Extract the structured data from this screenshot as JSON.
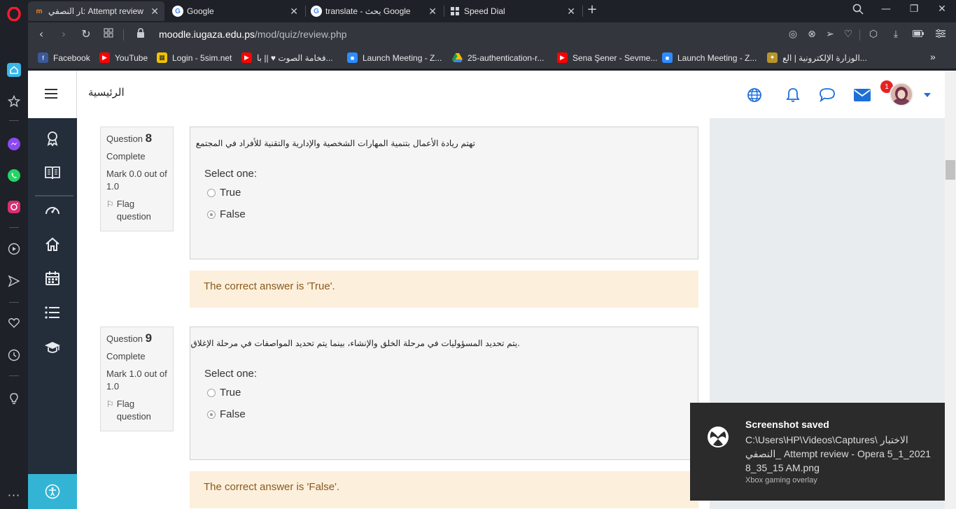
{
  "browser": {
    "tabs": [
      {
        "title": "ﺎﺭ ﺍﻟﻨﺼﻔﻲ: Attempt review",
        "icon": "moodle-icon",
        "active": true
      },
      {
        "title": "Google",
        "icon": "google-icon",
        "active": false
      },
      {
        "title": "translate - ﺑﺤﺚ Google",
        "icon": "google-icon",
        "active": false
      },
      {
        "title": "Speed Dial",
        "icon": "speed-dial-icon",
        "active": false
      }
    ],
    "new_tab": "+",
    "url_host": "moodle.iugaza.edu.ps",
    "url_path": "/mod/quiz/review.php",
    "bookmarks": [
      {
        "label": "Facebook",
        "icon": "facebook-icon"
      },
      {
        "label": "YouTube",
        "icon": "youtube-icon"
      },
      {
        "label": "Login - 5sim.net",
        "icon": "5sim-icon"
      },
      {
        "label": "ﻓﺨﺎﻣﺔ ﺍﻟﺼﻮﺕ ♥ || ﺑﺎ...",
        "icon": "youtube-icon"
      },
      {
        "label": "Launch Meeting - Z...",
        "icon": "zoom-icon"
      },
      {
        "label": "25-authentication-r...",
        "icon": "drive-icon"
      },
      {
        "label": "Sena Şener - Sevme...",
        "icon": "youtube-icon"
      },
      {
        "label": "Launch Meeting - Z...",
        "icon": "zoom-icon"
      },
      {
        "label": "ﺍﻟﻮﺯﺍﺭﺓ ﺍﻹﻟﻜﺘﺮﻭﻧﻴﺔ | ﺍﻟﻊ...",
        "icon": "ministry-icon"
      }
    ],
    "bookmarks_more": "»"
  },
  "moodle": {
    "home_title": "ﺍﻟﺮﺋﻴﺴﻴﺔ",
    "notification_count": "1",
    "accent": "#1d6fd8"
  },
  "questions": [
    {
      "label": "Question",
      "number": "8",
      "state": "Complete",
      "mark": "Mark 0.0 out of 1.0",
      "flag": "Flag question",
      "text": "ﺗﻬﺘﻢ ﺭﻳﺎﺩﺓ ﺍﻷﻋﻤﺎﻝ ﺑﺘﻨﻤﻴﺔ ﺍﻟﻤﻬﺎﺭﺍﺕ ﺍﻟﺸﺨﺼﻴﺔ ﻭﺍﻹﺩﺍﺭﻳﺔ ﻭﺍﻟﺘﻘﻨﻴﺔ ﻟﻸﻓﺮﺍﺩ ﻓﻲ ﺍﻟﻤﺠﺘﻤﻊ",
      "prompt": "Select one:",
      "options": [
        "True",
        "False"
      ],
      "selected": "False",
      "feedback": "The correct answer is 'True'."
    },
    {
      "label": "Question",
      "number": "9",
      "state": "Complete",
      "mark": "Mark 1.0 out of 1.0",
      "flag": "Flag question",
      "text": ".ﻳﺘﻢ ﺗﺤﺪﻳﺪ ﺍﻟﻤﺴﺆﻮﻟﻴﺎﺕ ﻓﻲ ﻣﺮﺣﻠﺔ ﺍﻟﺨﻠﻖ ﻭﺍﻹﻧﺸﺎﺀ، ﺑﻴﻨﻤﺎ ﻳﺘﻢ ﺗﺤﺪﻳﺪ ﺍﻟﻤﻮﺍﺻﻔﺎﺕ ﻓﻲ ﻣﺮﺣﻠﺔ ﺍﻹﻏﻼﻕ",
      "prompt": "Select one:",
      "options": [
        "True",
        "False"
      ],
      "selected": "False",
      "feedback": "The correct answer is 'False'."
    }
  ],
  "toast": {
    "title": "Screenshot saved",
    "body": "C:\\Users\\HP\\Videos\\Captures\\ ﺍﻻﺧﺘﺒﺎﺭ ﺍﻟﻨﺼﻔﻲ_ Attempt review - Opera 5_1_2021 8_35_15 AM.png",
    "footer": "Xbox gaming overlay"
  }
}
